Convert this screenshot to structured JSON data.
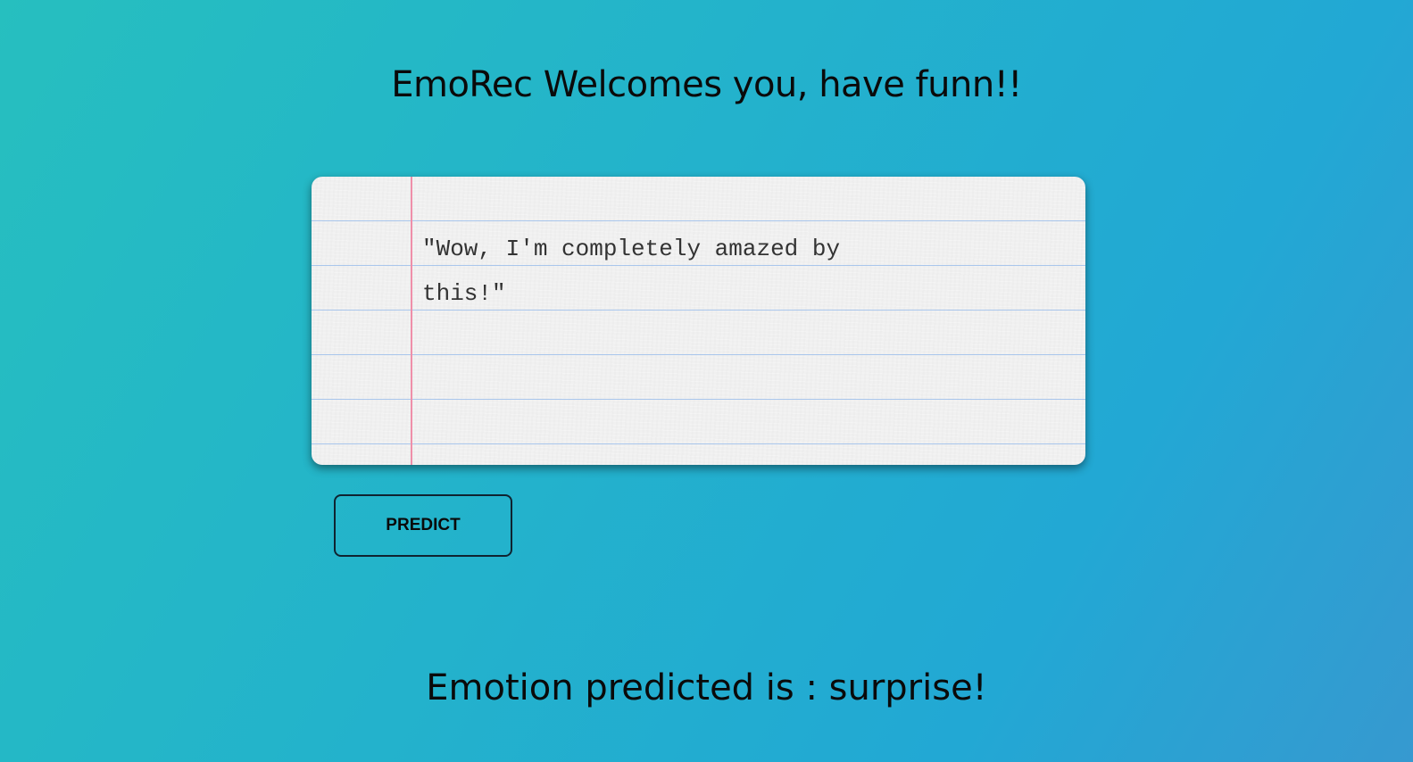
{
  "header": {
    "title": "EmoRec Welcomes you, have funn!!"
  },
  "input": {
    "text": "\"Wow, I'm completely amazed by this!\""
  },
  "actions": {
    "predict_label": "PREDICT"
  },
  "result": {
    "text": "Emotion predicted is : surprise!"
  },
  "colors": {
    "background_start": "#26bfbf",
    "background_end": "#22a8d4",
    "paper": "#f0f0f0",
    "rule_line": "#a9c6ec",
    "margin_line": "#ef8fa9"
  }
}
